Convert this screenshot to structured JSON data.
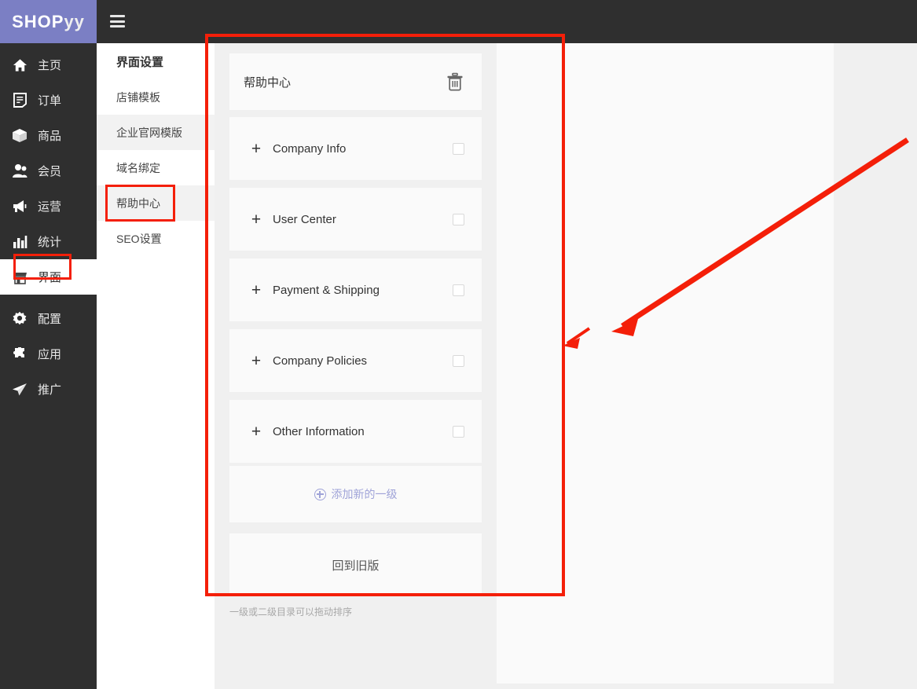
{
  "brand": {
    "logo_main": "SHOP",
    "logo_tail": "yy",
    "accent_color": "#7b7fc4"
  },
  "topbar": {
    "menu_toggle": "hamburger-menu"
  },
  "sidebar": {
    "items": [
      {
        "label": "主页",
        "icon": "home-icon",
        "active": false
      },
      {
        "label": "订单",
        "icon": "order-icon",
        "active": false
      },
      {
        "label": "商品",
        "icon": "product-icon",
        "active": false
      },
      {
        "label": "会员",
        "icon": "member-icon",
        "active": false
      },
      {
        "label": "运营",
        "icon": "megaphone-icon",
        "active": false
      },
      {
        "label": "统计",
        "icon": "chart-icon",
        "active": false
      },
      {
        "label": "界面",
        "icon": "interface-icon",
        "active": true
      },
      {
        "label": "配置",
        "icon": "gear-icon",
        "active": false
      },
      {
        "label": "应用",
        "icon": "puzzle-icon",
        "active": false
      },
      {
        "label": "推广",
        "icon": "plane-icon",
        "active": false
      }
    ]
  },
  "subnav": {
    "title": "界面设置",
    "items": [
      {
        "label": "店铺模板",
        "shaded": false,
        "selected": false
      },
      {
        "label": "企业官网模版",
        "shaded": true,
        "selected": false
      },
      {
        "label": "域名绑定",
        "shaded": false,
        "selected": false
      },
      {
        "label": "帮助中心",
        "shaded": true,
        "selected": true
      },
      {
        "label": "SEO设置",
        "shaded": false,
        "selected": false
      }
    ]
  },
  "main": {
    "header_card": {
      "title": "帮助中心",
      "delete_icon": "trash-icon"
    },
    "rows": [
      {
        "label": "Company Info",
        "checked": false
      },
      {
        "label": "User Center",
        "checked": false
      },
      {
        "label": "Payment & Shipping",
        "checked": false
      },
      {
        "label": "Company Policies",
        "checked": false
      },
      {
        "label": "Other Information",
        "checked": false
      }
    ],
    "add_button": {
      "label": "添加新的一级",
      "icon": "circle-plus-icon",
      "color": "#9fa3d8"
    },
    "legacy_button": {
      "label": "回到旧版"
    },
    "hint": "一级或二级目录可以拖动排序"
  },
  "annotations": {
    "color": "#f41f09",
    "main_highlight": "main-panel-highlight",
    "subnav_highlight": "帮助中心",
    "sidebar_highlight": "界面",
    "arrow": "arrow-pointing-to-main-panel"
  }
}
